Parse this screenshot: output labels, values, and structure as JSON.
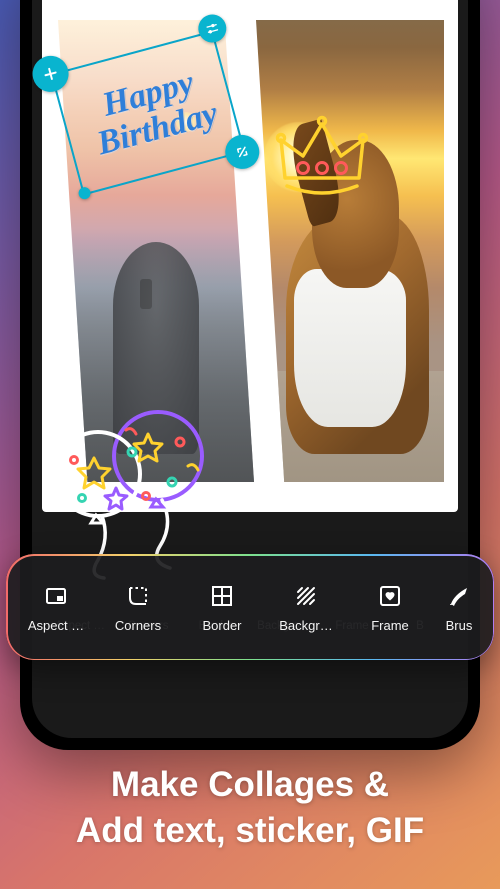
{
  "overlay_text": {
    "line1": "Happy",
    "line2": "Birthday"
  },
  "stickers": {
    "crown": "crown-neon-sticker",
    "balloons": "balloons-neon-sticker"
  },
  "colors": {
    "selection": "#0aa5c9",
    "headline": "#ffffff"
  },
  "toolbar_primary": [
    {
      "icon": "aspect-ratio-icon",
      "label": "Aspect …"
    },
    {
      "icon": "corners-icon",
      "label": "Corners"
    },
    {
      "icon": "border-icon",
      "label": "Border"
    },
    {
      "icon": "background-icon",
      "label": "Backgr…"
    },
    {
      "icon": "frame-icon",
      "label": "Frame"
    },
    {
      "icon": "brush-icon",
      "label": "Brus"
    }
  ],
  "toolbar_secondary": [
    {
      "label": "Aspect …"
    },
    {
      "label": "Corners"
    },
    {
      "label": "Border"
    },
    {
      "label": "Backgro…"
    },
    {
      "label": "Frame"
    },
    {
      "label": "B"
    }
  ],
  "headline": {
    "line1": "Make Collages &",
    "line2": "Add text, sticker, GIF"
  }
}
